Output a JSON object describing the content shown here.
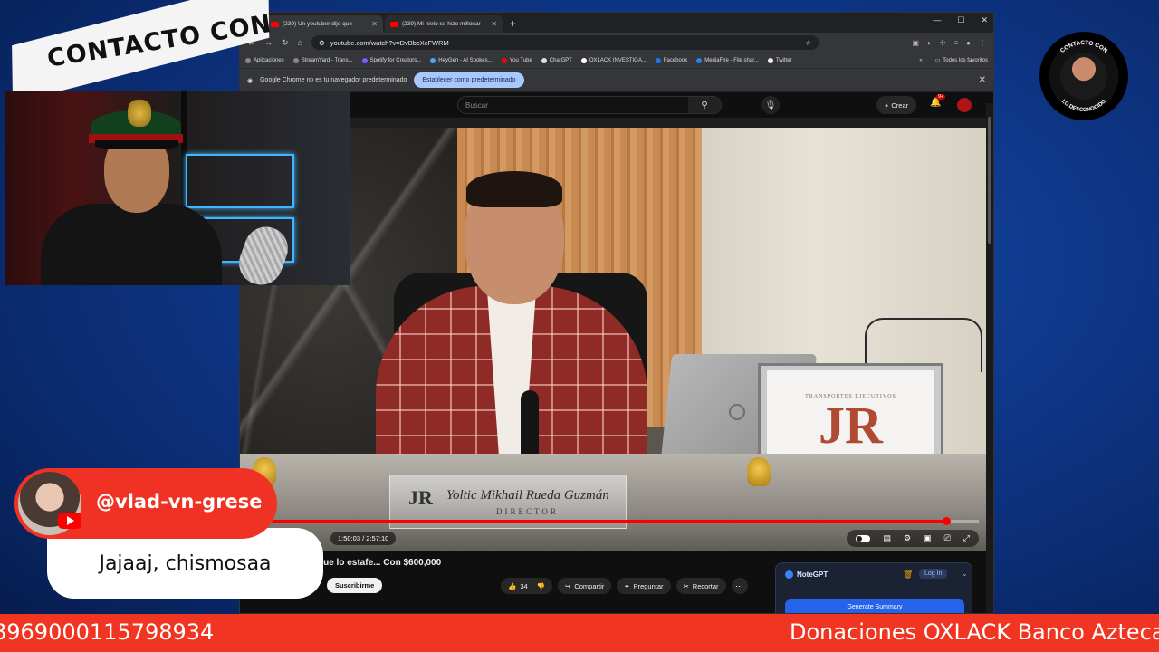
{
  "browser": {
    "tabs": [
      {
        "title": "(239) Un youtuber dijo que",
        "active": true
      },
      {
        "title": "(239) Mi nieto se hizo millonar",
        "active": false
      }
    ],
    "url": "youtube.com/watch?v=DvBbcXcFWRM",
    "bookmarks": [
      "Aplicaciones",
      "StreamYard - Trans...",
      "Spotify for Creators...",
      "HeyGen - AI Spokes...",
      "You Tube",
      "ChatGPT",
      "OXLACK INVESTIGA...",
      "Facebook",
      "MediaFire - File shar...",
      "Twitter"
    ],
    "bookmarks_all": "Todos los favoritos",
    "infobar_text": "Google Chrome no es tu navegador predeterminado",
    "infobar_button": "Establecer como predeterminado"
  },
  "youtube": {
    "search_placeholder": "Buscar",
    "create_label": "Crear",
    "notif_badge": "9+",
    "video": {
      "sign_subtitle": "TRANSPORTES EJECUTIVOS",
      "sign_logo": "JR",
      "nameplate_logo": "JR",
      "nameplate_name": "Yoltic Mikhail Rueda Guzmán",
      "nameplate_title": "DIRECTOR",
      "time_display": "1:50:03 / 2:57:10",
      "progress": 0.955
    },
    "title": "que lo estafe... Con $600,000",
    "subscribe_label": "Suscribirme",
    "like_count": "34",
    "share_label": "Compartir",
    "ask_label": "Preguntar",
    "clip_label": "Recortar",
    "notegpt": {
      "title": "NoteGPT",
      "login": "Log In",
      "generate": "Generate Summary"
    }
  },
  "overlay": {
    "banner_text": "CONTACTO CON",
    "chat_user": "@vlad-vn-grese",
    "chat_message": "Jajaaj, chismosaa",
    "ticker_left": "8969000115798934",
    "ticker_right": "Donaciones OXLACK Banco Azteca",
    "logo_ring_top": "CONTACTO CON",
    "logo_ring_bottom": "LO DESCONOCIDO"
  },
  "colors": {
    "accent_red": "#f03522",
    "yt_red": "#ff0000",
    "background_blue": "#0f3a8e"
  }
}
